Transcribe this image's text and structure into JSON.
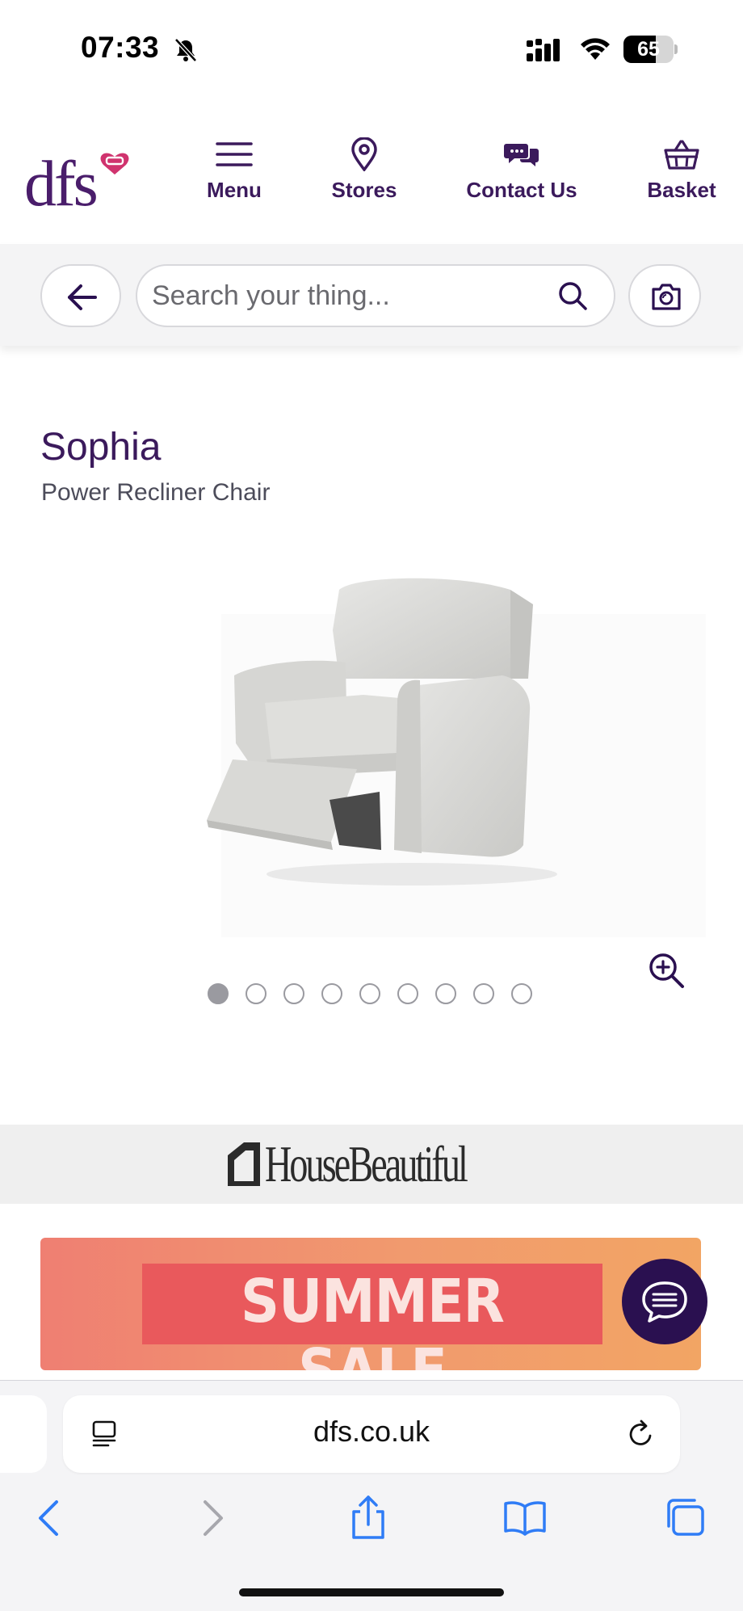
{
  "status_bar": {
    "time": "07:33",
    "battery": "65",
    "battery_level": 0.65
  },
  "header": {
    "logo_text": "dfs",
    "nav": [
      {
        "label": "Menu",
        "icon": "hamburger-icon"
      },
      {
        "label": "Stores",
        "icon": "location-pin-icon"
      },
      {
        "label": "Contact Us",
        "icon": "chat-bubbles-icon"
      },
      {
        "label": "Basket",
        "icon": "basket-icon"
      }
    ],
    "brand_color": "#3b1a5c",
    "logo_heart_color": "#d0336e"
  },
  "search": {
    "placeholder": "Search your thing...",
    "back_icon": "arrow-left-icon",
    "search_icon": "magnifier-icon",
    "camera_icon": "camera-icon"
  },
  "product": {
    "name": "Sophia",
    "type": "Power Recliner Chair",
    "image_count": 9,
    "active_image": 1,
    "zoom_icon": "zoom-in-icon"
  },
  "press": {
    "logo": "HouseBeautiful"
  },
  "promo": {
    "text": "SUMMER SALE",
    "chat_icon": "chat-icon"
  },
  "browser": {
    "url": "dfs.co.uk",
    "toolbar": [
      "back",
      "forward",
      "share",
      "bookmarks",
      "tabs"
    ],
    "accent_color": "#2f7cf6"
  }
}
